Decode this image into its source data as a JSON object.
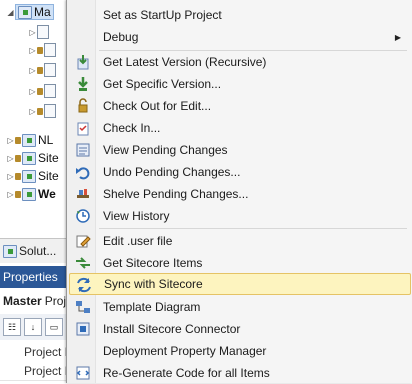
{
  "solution_tree": {
    "items": [
      {
        "label": "Ma",
        "icon": "project-icon"
      },
      {
        "label": "",
        "icon": "file-icon"
      },
      {
        "label": "",
        "icon": "file-icon"
      },
      {
        "label": "",
        "icon": "file-icon"
      },
      {
        "label": "",
        "icon": "file-icon"
      },
      {
        "label": "",
        "icon": "file-icon"
      },
      {
        "label": "NL",
        "icon": "project-icon"
      },
      {
        "label": "Site",
        "icon": "project-icon"
      },
      {
        "label": "Site",
        "icon": "project-icon"
      },
      {
        "label": "We",
        "icon": "project-icon"
      }
    ]
  },
  "solution_tab": {
    "label": "Solut..."
  },
  "properties": {
    "title": "Properties",
    "object": "Master",
    "object_suffix": "Proj",
    "rows": [
      {
        "label": "Project I"
      },
      {
        "label": "Project I"
      }
    ]
  },
  "context_menu": {
    "items": [
      {
        "label": "Set as StartUp Project",
        "icon": ""
      },
      {
        "label": "Debug",
        "icon": "",
        "submenu": true
      },
      {
        "label": "Get Latest Version (Recursive)",
        "icon": "get-latest-icon"
      },
      {
        "label": "Get Specific Version...",
        "icon": "get-specific-icon"
      },
      {
        "label": "Check Out for Edit...",
        "icon": "check-out-icon"
      },
      {
        "label": "Check In...",
        "icon": "check-in-icon"
      },
      {
        "label": "View Pending Changes",
        "icon": "pending-changes-icon"
      },
      {
        "label": "Undo Pending Changes...",
        "icon": "undo-icon"
      },
      {
        "label": "Shelve Pending Changes...",
        "icon": "shelve-icon"
      },
      {
        "label": "View History",
        "icon": "history-icon"
      },
      {
        "label": "Edit .user file",
        "icon": "edit-icon"
      },
      {
        "label": "Get Sitecore Items",
        "icon": "get-sitecore-icon"
      },
      {
        "label": "Sync with Sitecore",
        "icon": "sync-icon",
        "highlighted": true
      },
      {
        "label": "Template Diagram",
        "icon": "template-diagram-icon"
      },
      {
        "label": "Install Sitecore Connector",
        "icon": "connector-icon"
      },
      {
        "label": "Deployment Property Manager",
        "icon": "deployment-icon"
      },
      {
        "label": "Re-Generate Code for all Items",
        "icon": "regenerate-icon"
      }
    ]
  },
  "colors": {
    "highlight": "#fdf4bf",
    "highlight_border": "#e5c365",
    "properties_title_bg": "#2b5797"
  }
}
